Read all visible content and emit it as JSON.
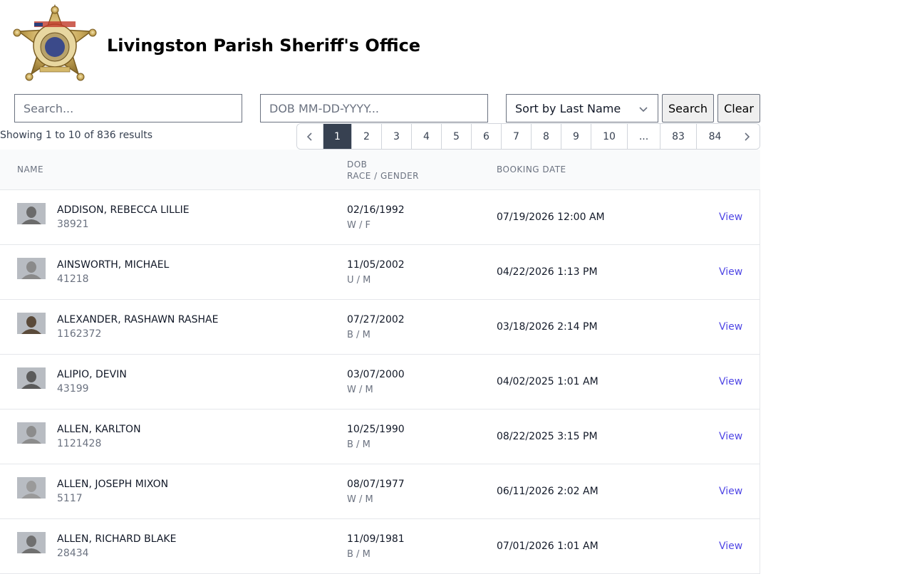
{
  "header": {
    "title": "Livingston Parish Sheriff's Office"
  },
  "search": {
    "placeholder": "Search...",
    "value": ""
  },
  "dob": {
    "placeholder": "DOB MM-DD-YYYY...",
    "value": ""
  },
  "sort": {
    "selected": "Sort by Last Name"
  },
  "buttons": {
    "search": "Search",
    "clear": "Clear"
  },
  "results": {
    "summary": "Showing 1 to 10 of 836 results"
  },
  "pagination": {
    "pages": [
      "1",
      "2",
      "3",
      "4",
      "5",
      "6",
      "7",
      "8",
      "9",
      "10",
      "...",
      "83",
      "84"
    ],
    "current": "1"
  },
  "table": {
    "headers": {
      "name": "NAME",
      "dob": "DOB",
      "race_gender": "RACE / GENDER",
      "booking": "BOOKING DATE"
    },
    "view_label": "View",
    "rows": [
      {
        "name": "ADDISON, REBECCA LILLIE",
        "id": "38921",
        "dob": "02/16/1992",
        "rg": "W / F",
        "booking": "07/19/2026 12:00 AM",
        "thumb": "#6b6b6b"
      },
      {
        "name": "AINSWORTH, MICHAEL",
        "id": "41218",
        "dob": "11/05/2002",
        "rg": "U / M",
        "booking": "04/22/2026 1:13 PM",
        "thumb": "#8a8a8a"
      },
      {
        "name": "ALEXANDER, RASHAWN RASHAE",
        "id": "1162372",
        "dob": "07/27/2002",
        "rg": "B / M",
        "booking": "03/18/2026 2:14 PM",
        "thumb": "#5a4a3a"
      },
      {
        "name": "ALIPIO, DEVIN",
        "id": "43199",
        "dob": "03/07/2000",
        "rg": "W / M",
        "booking": "04/02/2025 1:01 AM",
        "thumb": "#5b5b5b"
      },
      {
        "name": "ALLEN, KARLTON",
        "id": "1121428",
        "dob": "10/25/1990",
        "rg": "B / M",
        "booking": "08/22/2025 3:15 PM",
        "thumb": "#8c8c8c"
      },
      {
        "name": "ALLEN, JOSEPH MIXON",
        "id": "5117",
        "dob": "08/07/1977",
        "rg": "W / M",
        "booking": "06/11/2026 2:02 AM",
        "thumb": "#9a9a9a"
      },
      {
        "name": "ALLEN, RICHARD BLAKE",
        "id": "28434",
        "dob": "11/09/1981",
        "rg": "B / M",
        "booking": "07/01/2026 1:01 AM",
        "thumb": "#707070"
      }
    ]
  }
}
